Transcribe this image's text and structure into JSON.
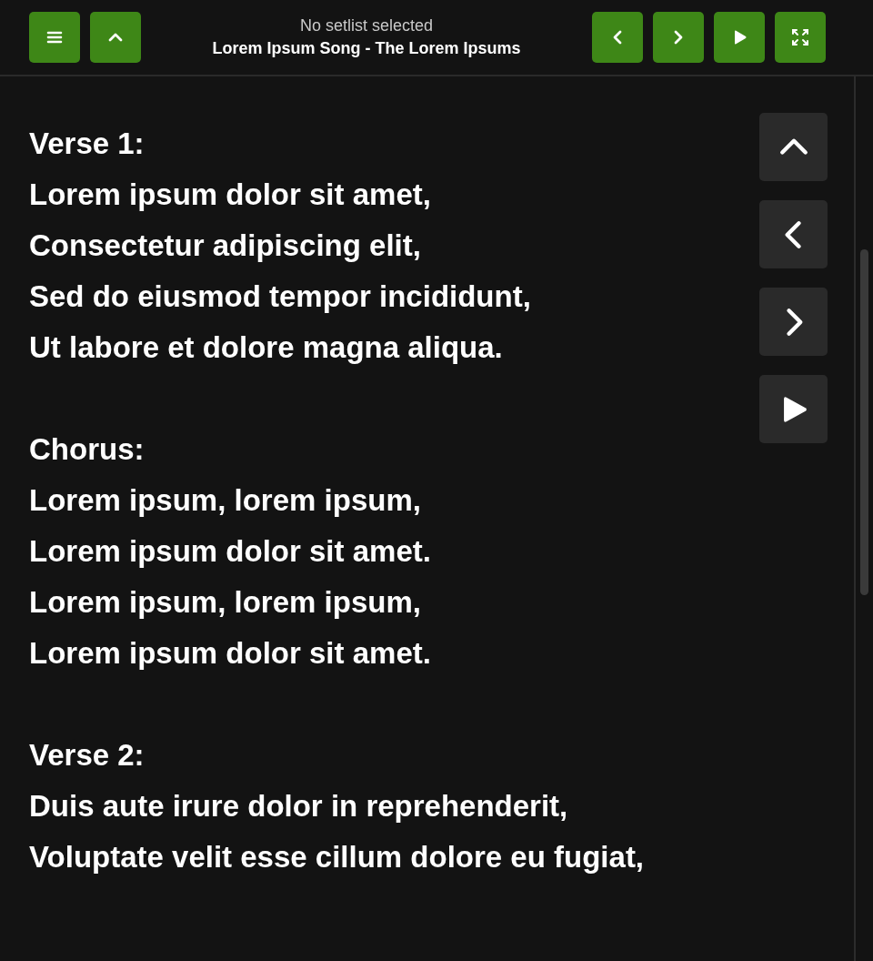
{
  "header": {
    "setlist": "No setlist selected",
    "song": "Lorem Ipsum Song - The Lorem Ipsums"
  },
  "stanzas": [
    {
      "lines": [
        "Verse 1:",
        "Lorem ipsum dolor sit amet,",
        "Consectetur adipiscing elit,",
        "Sed do eiusmod tempor incididunt,",
        "Ut labore et dolore magna aliqua."
      ]
    },
    {
      "lines": [
        "Chorus:",
        "Lorem ipsum, lorem ipsum,",
        "Lorem ipsum dolor sit amet.",
        "Lorem ipsum, lorem ipsum,",
        "Lorem ipsum dolor sit amet."
      ]
    },
    {
      "lines": [
        "Verse 2:",
        "Duis aute irure dolor in reprehenderit,",
        "Voluptate velit esse cillum dolore eu fugiat,"
      ]
    }
  ]
}
